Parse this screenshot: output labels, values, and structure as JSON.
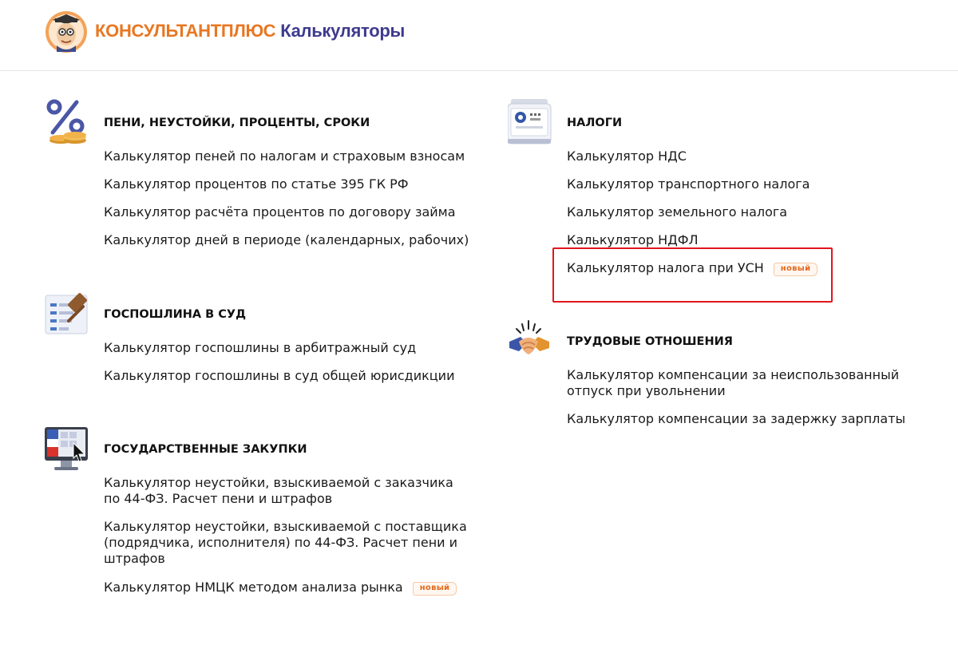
{
  "header": {
    "brand_main": "КонсультантПлюс",
    "brand_sub": "Калькуляторы"
  },
  "sections": {
    "peni": {
      "icon": "percent-coins-icon",
      "title": "Пени, неустойки, проценты, сроки",
      "links": [
        "Калькулятор пеней по налогам и страховым взносам",
        "Калькулятор процентов по статье 395 ГК РФ",
        "Калькулятор расчёта процентов по договору займа",
        "Калькулятор дней в периоде (календарных, рабочих)"
      ]
    },
    "gosposhlina": {
      "icon": "gavel-document-icon",
      "title": "Госпошлина в суд",
      "links": [
        "Калькулятор госпошлины в арбитражный суд",
        "Калькулятор госпошлины в суд общей юрисдикции"
      ]
    },
    "zakupki": {
      "icon": "monitor-cursor-icon",
      "title": "Государственные закупки",
      "links": [
        "Калькулятор неустойки, взыскиваемой с заказчика",
        "по 44-ФЗ. Расчет пени и штрафов",
        "Калькулятор неустойки, взыскиваемой с поставщика",
        "(подрядчика, исполнителя) по 44-ФЗ. Расчет пени и",
        "штрафов",
        "Калькулятор НМЦК методом анализа рынка"
      ],
      "new_tag": "новый"
    },
    "nalogi": {
      "icon": "tax-printer-icon",
      "title": "Налоги",
      "links": [
        "Калькулятор НДС",
        "Калькулятор транспортного налога",
        "Калькулятор земельного налога",
        "Калькулятор НДФЛ",
        "Калькулятор налога при УСН"
      ],
      "new_tag": "новый"
    },
    "trud": {
      "icon": "handshake-icon",
      "title": "Трудовые отношения",
      "links": [
        "Калькулятор компенсации за неиспользованный",
        "отпуск при увольнении",
        "Калькулятор компенсации за задержку зарплаты"
      ]
    }
  },
  "colors": {
    "brand_orange": "#e87722",
    "brand_purple": "#3e3a8f",
    "highlight_red": "#e0161e",
    "tag_orange": "#e36a1e"
  }
}
